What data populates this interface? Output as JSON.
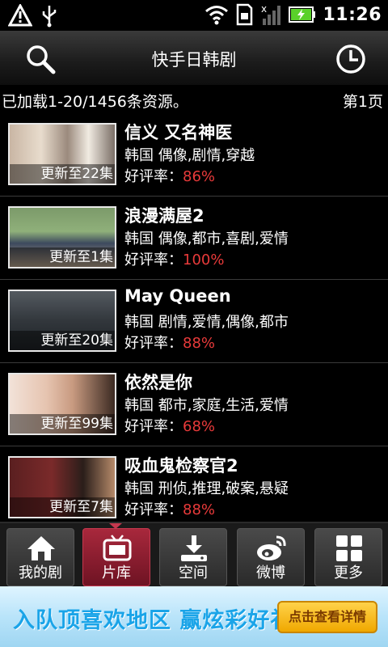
{
  "status_bar": {
    "time": "11:26",
    "icons": [
      "alert-icon",
      "usb-icon",
      "wifi-icon",
      "sd-card-icon",
      "signal-off-icon",
      "battery-charging-icon"
    ]
  },
  "header": {
    "title": "快手日韩剧",
    "icons": [
      "search-icon",
      "history-icon"
    ]
  },
  "info": {
    "loaded_text": "已加载1-20/1456条资源。",
    "page_text": "第1页"
  },
  "shows": [
    {
      "title": "信义 又名神医",
      "meta": "韩国  偶像,剧情,穿越",
      "rate_label": "好评率：",
      "rate": "86%",
      "badge": "更新至22集"
    },
    {
      "title": "浪漫满屋2",
      "meta": "韩国  偶像,都市,喜剧,爱情",
      "rate_label": "好评率：",
      "rate": "100%",
      "badge": "更新至1集"
    },
    {
      "title": "May Queen",
      "meta": "韩国  剧情,爱情,偶像,都市",
      "rate_label": "好评率：",
      "rate": "88%",
      "badge": "更新至20集"
    },
    {
      "title": "依然是你",
      "meta": "韩国  都市,家庭,生活,爱情",
      "rate_label": "好评率：",
      "rate": "68%",
      "badge": "更新至99集"
    },
    {
      "title": "吸血鬼检察官2",
      "meta": "韩国  刑侦,推理,破案,悬疑",
      "rate_label": "好评率：",
      "rate": "88%",
      "badge": "更新至7集"
    }
  ],
  "tabs": [
    {
      "label": "我的剧",
      "icon": "home-icon",
      "active": false
    },
    {
      "label": "片库",
      "icon": "tv-icon",
      "active": true
    },
    {
      "label": "空间",
      "icon": "download-icon",
      "active": false
    },
    {
      "label": "微博",
      "icon": "weibo-icon",
      "active": false
    },
    {
      "label": "更多",
      "icon": "grid-icon",
      "active": false
    }
  ],
  "ad": {
    "text": "入队顶喜欢地区 赢炫彩好礼",
    "button": "点击查看详情"
  },
  "colors": {
    "rate": "#e83a3a",
    "active_tab": "#a8283c",
    "ad_text": "#1aa4e8"
  }
}
